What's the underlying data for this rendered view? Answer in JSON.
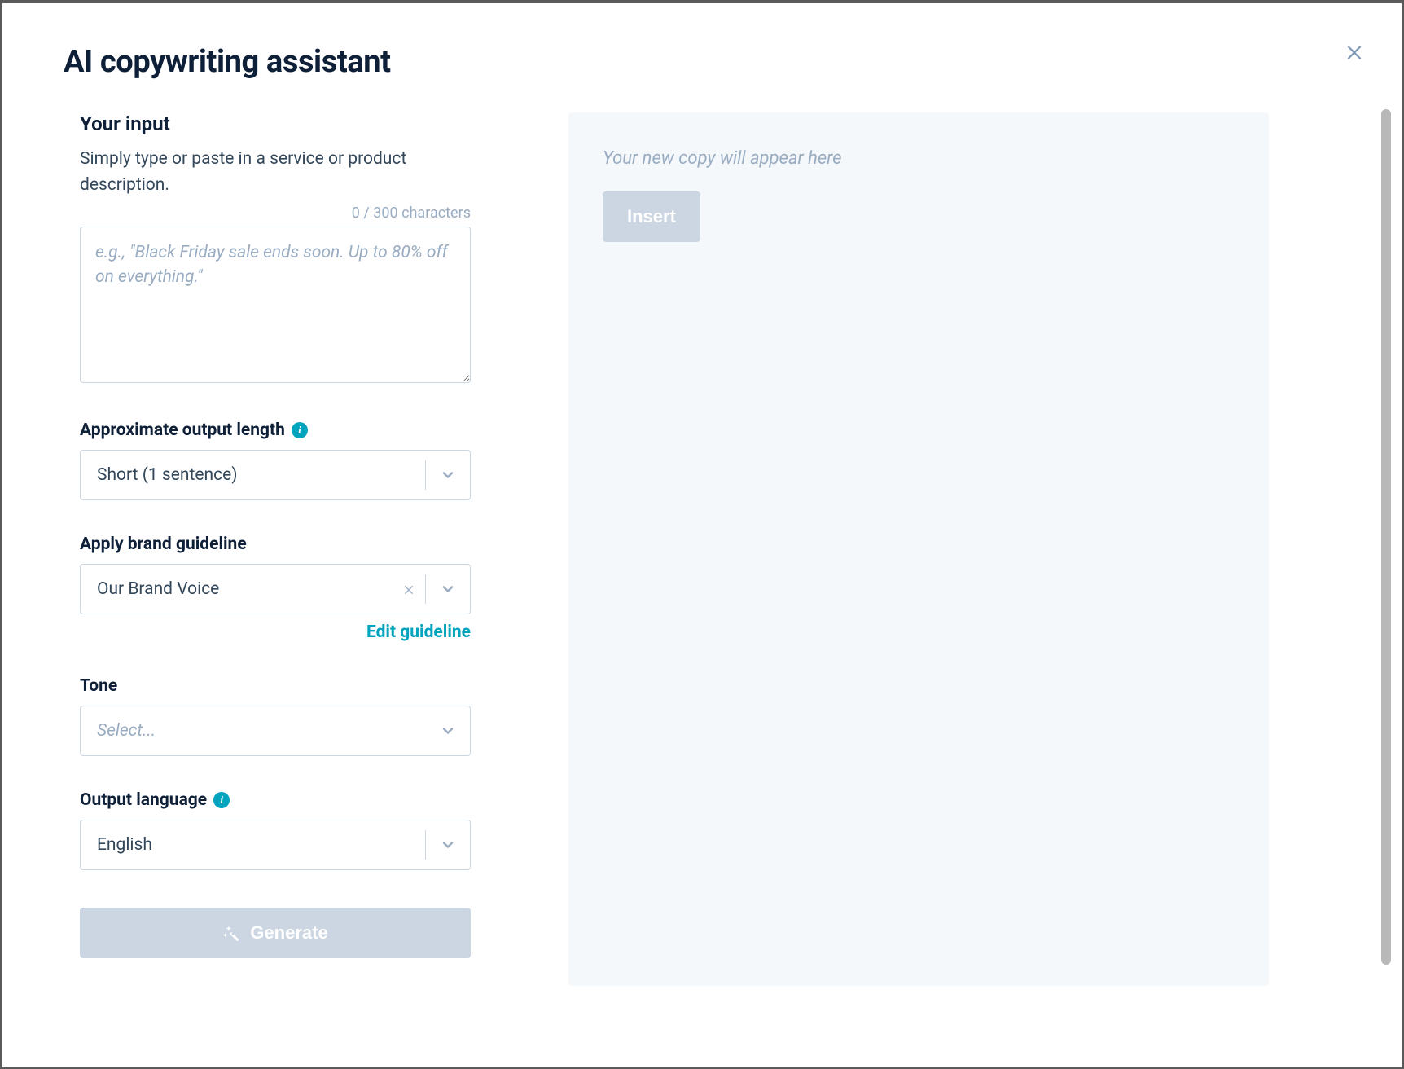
{
  "modal": {
    "title": "AI copywriting assistant"
  },
  "input": {
    "section_title": "Your input",
    "helper_text": "Simply type or paste in a service or product description.",
    "char_counter": "0 / 300 characters",
    "placeholder": "e.g., \"Black Friday sale ends soon. Up to 80% off on everything.\""
  },
  "fields": {
    "output_length": {
      "label": "Approximate output length",
      "value": "Short (1 sentence)"
    },
    "brand_guideline": {
      "label": "Apply brand guideline",
      "value": "Our Brand Voice",
      "edit_link": "Edit guideline"
    },
    "tone": {
      "label": "Tone",
      "placeholder": "Select..."
    },
    "output_language": {
      "label": "Output language",
      "value": "English"
    }
  },
  "actions": {
    "generate": "Generate",
    "insert": "Insert"
  },
  "output": {
    "placeholder": "Your new copy will appear here"
  }
}
